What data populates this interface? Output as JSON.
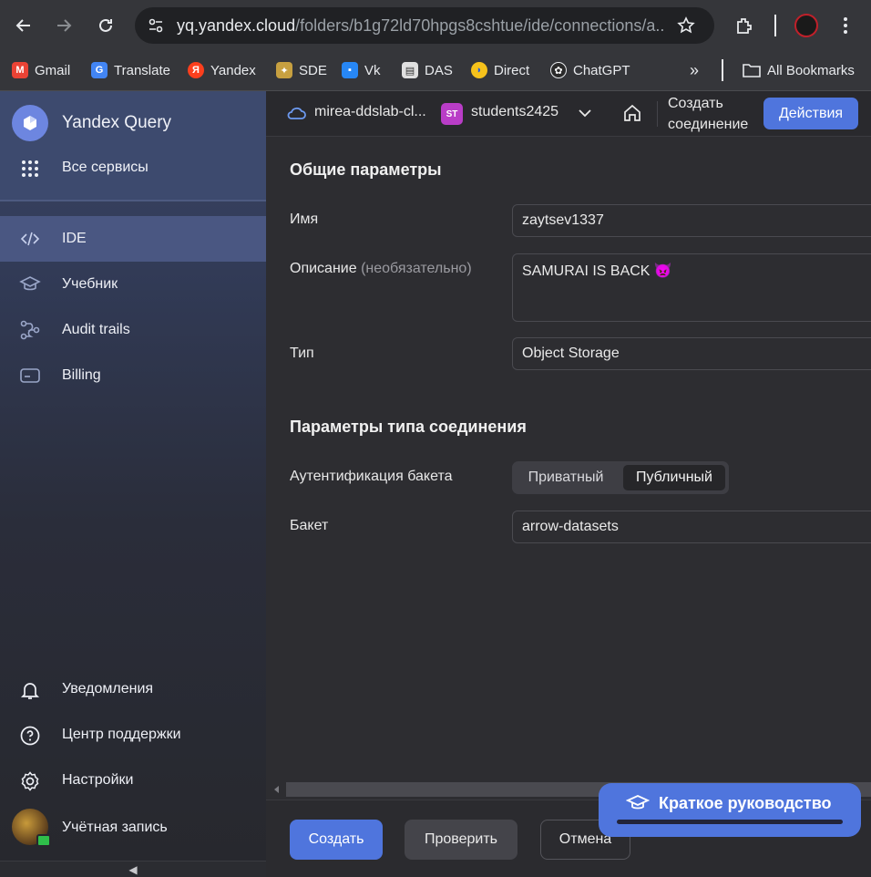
{
  "browser": {
    "url_host": "yq.yandex.cloud",
    "url_path": "/folders/b1g72ld70hpgs8cshtue/ide/connections/a...",
    "bookmarks": [
      "Gmail",
      "Translate",
      "Yandex",
      "SDE",
      "Vk",
      "DAS",
      "Direct",
      "ChatGPT"
    ],
    "more": "»",
    "all_bookmarks": "All Bookmarks"
  },
  "sidebar": {
    "app_title": "Yandex Query",
    "all_services": "Все сервисы",
    "items": [
      {
        "label": "IDE",
        "icon": "code-icon",
        "active": true
      },
      {
        "label": "Учебник",
        "icon": "graduation-cap-icon",
        "active": false
      },
      {
        "label": "Audit trails",
        "icon": "audit-trails-icon",
        "active": false
      },
      {
        "label": "Billing",
        "icon": "credit-card-icon",
        "active": false
      }
    ],
    "bottom": [
      {
        "label": "Уведомления",
        "icon": "bell-icon"
      },
      {
        "label": "Центр поддержки",
        "icon": "help-circle-icon"
      },
      {
        "label": "Настройки",
        "icon": "gear-icon"
      },
      {
        "label": "Учётная запись",
        "icon": "avatar"
      }
    ],
    "collapse": "◀"
  },
  "topbar": {
    "cloud": "mirea-ddslab-cl...",
    "folder_badge": "ST",
    "folder": "students2425",
    "create_connection": [
      "Создать",
      "соединение"
    ],
    "actions": "Действия"
  },
  "form": {
    "general_title": "Общие параметры",
    "name_label": "Имя",
    "name_value": "zaytsev1337",
    "desc_label": "Описание",
    "desc_optional": "(необязательно)",
    "desc_value": "SAMURAI IS BACK 👿",
    "type_label": "Тип",
    "type_value": "Object Storage",
    "conn_params_title": "Параметры типа соединения",
    "auth_label": "Аутентификация бакета",
    "auth_options": [
      "Приватный",
      "Публичный"
    ],
    "auth_selected": "Публичный",
    "bucket_label": "Бакет",
    "bucket_value": "arrow-datasets"
  },
  "footer": {
    "create": "Создать",
    "check": "Проверить",
    "cancel": "Отмена"
  },
  "guide": {
    "label": "Краткое руководство"
  },
  "colors": {
    "accent": "#4f75dd",
    "badge": "#b93dc7",
    "sidebar_active": "#4a5782"
  }
}
